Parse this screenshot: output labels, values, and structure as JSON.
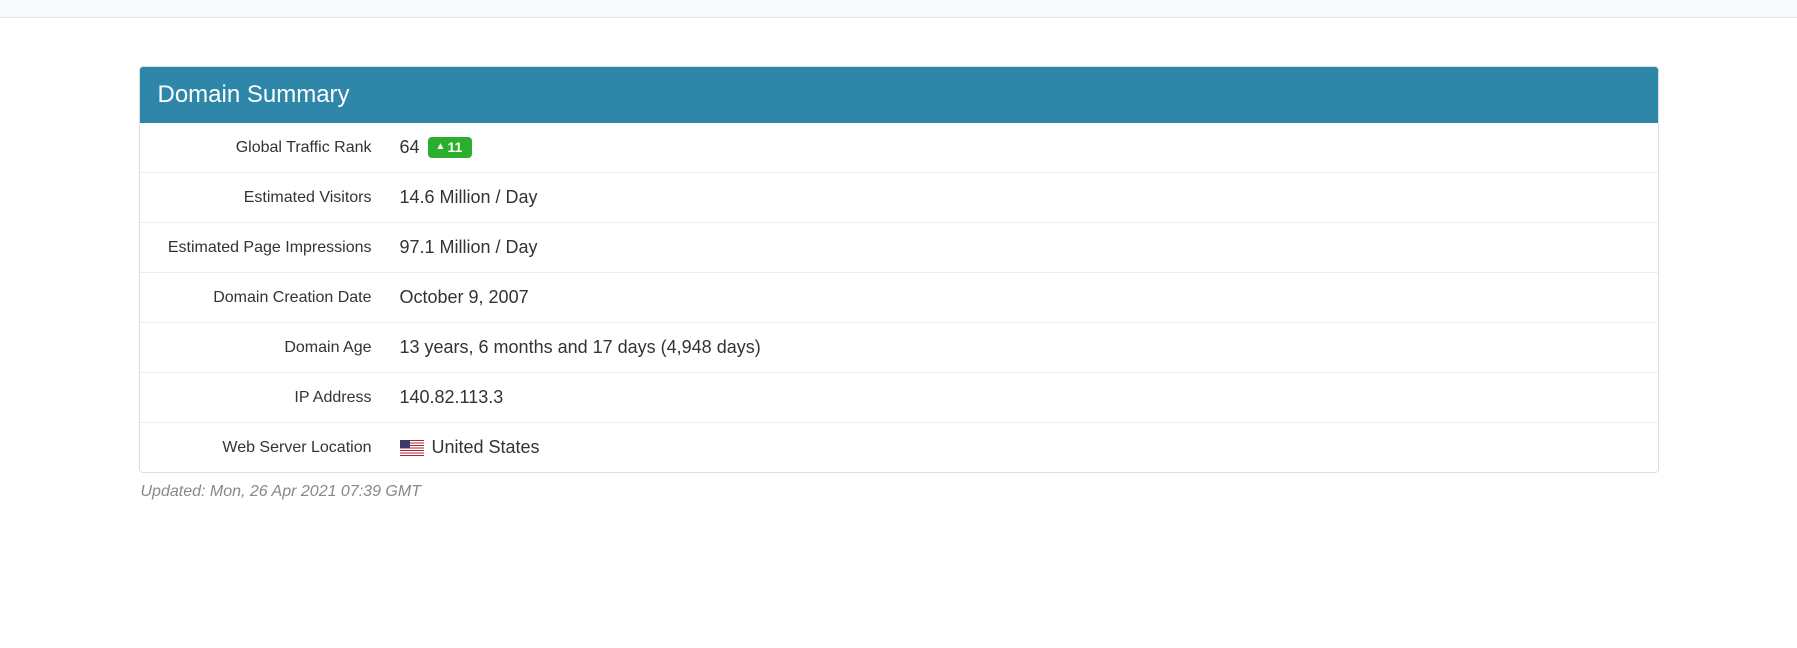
{
  "panel": {
    "title": "Domain Summary",
    "rows": {
      "traffic_rank": {
        "label": "Global Traffic Rank",
        "value": "64",
        "delta": "11"
      },
      "visitors": {
        "label": "Estimated Visitors",
        "value": "14.6 Million / Day"
      },
      "impressions": {
        "label": "Estimated Page Impressions",
        "value": "97.1 Million / Day"
      },
      "creation": {
        "label": "Domain Creation Date",
        "value": "October 9, 2007"
      },
      "age": {
        "label": "Domain Age",
        "value": "13 years, 6 months and 17 days (4,948 days)"
      },
      "ip": {
        "label": "IP Address",
        "value": "140.82.113.3"
      },
      "location": {
        "label": "Web Server Location",
        "value": "United States"
      }
    }
  },
  "updated": "Updated: Mon, 26 Apr 2021 07:39 GMT"
}
